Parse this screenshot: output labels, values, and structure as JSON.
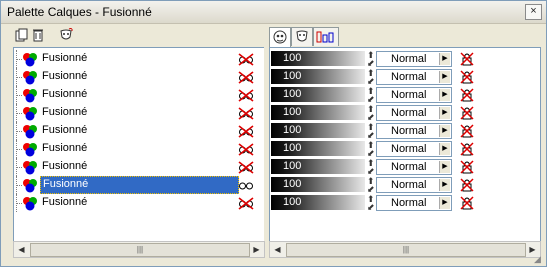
{
  "window": {
    "title": "Palette Calques - Fusionné",
    "close_glyph": "×"
  },
  "toolbar_left": [
    {
      "name": "new-layer-icon"
    },
    {
      "name": "delete-layer-icon"
    },
    {
      "name": "mask-icon"
    }
  ],
  "tabs": [
    {
      "name": "layer-properties-tab",
      "active": true
    },
    {
      "name": "mask-tab",
      "active": false
    },
    {
      "name": "blend-ranges-tab",
      "active": false
    }
  ],
  "layers": [
    {
      "name": "Fusionné",
      "opacity": "100",
      "blend": "Normal",
      "selected": false,
      "visible_icon": "hidden-eye-icon"
    },
    {
      "name": "Fusionné",
      "opacity": "100",
      "blend": "Normal",
      "selected": false,
      "visible_icon": "hidden-eye-icon"
    },
    {
      "name": "Fusionné",
      "opacity": "100",
      "blend": "Normal",
      "selected": false,
      "visible_icon": "hidden-eye-icon"
    },
    {
      "name": "Fusionné",
      "opacity": "100",
      "blend": "Normal",
      "selected": false,
      "visible_icon": "hidden-eye-icon"
    },
    {
      "name": "Fusionné",
      "opacity": "100",
      "blend": "Normal",
      "selected": false,
      "visible_icon": "hidden-eye-icon"
    },
    {
      "name": "Fusionné",
      "opacity": "100",
      "blend": "Normal",
      "selected": false,
      "visible_icon": "hidden-eye-icon"
    },
    {
      "name": "Fusionné",
      "opacity": "100",
      "blend": "Normal",
      "selected": false,
      "visible_icon": "hidden-eye-icon"
    },
    {
      "name": "Fusionné",
      "opacity": "100",
      "blend": "Normal",
      "selected": true,
      "visible_icon": "eye-glasses-icon"
    },
    {
      "name": "Fusionné",
      "opacity": "100",
      "blend": "Normal",
      "selected": false,
      "visible_icon": "hidden-eye-icon"
    }
  ],
  "scrollbar": {
    "left_arrow": "◀",
    "right_arrow": "▶",
    "thumb_grip": "|||"
  },
  "colors": {
    "selection": "#316ac5",
    "panel_border": "#7f9db9",
    "window_bg": "#ece9d8"
  }
}
